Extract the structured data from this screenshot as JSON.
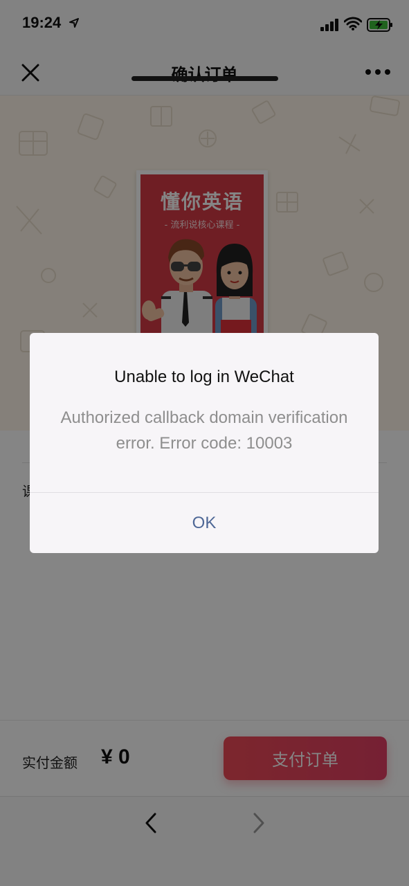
{
  "status_bar": {
    "time": "19:24",
    "icons": [
      "location-arrow-icon",
      "cellular-signal-icon",
      "wifi-icon",
      "battery-charging-icon"
    ],
    "battery_color": "#3fbf3a"
  },
  "nav": {
    "title": "确认订单",
    "close_icon": "close-icon",
    "more_icon": "more-options-icon"
  },
  "hero": {
    "cover_title": "懂你英语",
    "cover_subtitle": "- 流利说核心课程 -",
    "cover_color": "#d53b46"
  },
  "order": {
    "label": "课"
  },
  "payment": {
    "amount_label": "实付金额",
    "amount_value": "¥ 0",
    "pay_button": "支付订单",
    "accent": "#e84656"
  },
  "browser": {
    "back_icon": "chevron-left-icon",
    "forward_icon": "chevron-right-icon"
  },
  "dialog": {
    "title": "Unable to log in WeChat",
    "message": "Authorized callback domain verification error. Error code: 10003",
    "ok_label": "OK",
    "ok_color": "#4e6796"
  }
}
